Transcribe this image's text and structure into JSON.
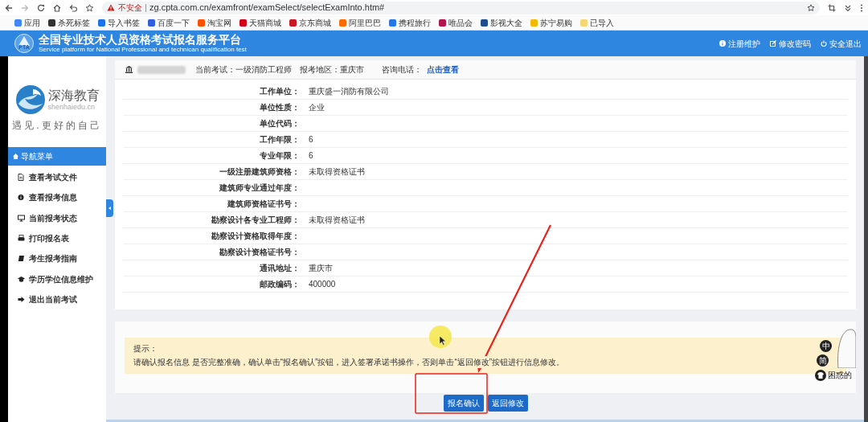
{
  "browser": {
    "security_label": "不安全",
    "url": "zg.cpta.com.cn/examfront/examSelect/selectExamInto.htm#",
    "bookmarks": [
      {
        "label": "应用",
        "color": "#4285f4"
      },
      {
        "label": "杀死标签",
        "color": "#333333"
      },
      {
        "label": "导入书签",
        "color": "#1a73e8"
      },
      {
        "label": "百度一下",
        "color": "#2f5ee0"
      },
      {
        "label": "淘宝网",
        "color": "#ff5000"
      },
      {
        "label": "天猫商城",
        "color": "#d4001a"
      },
      {
        "label": "京东商城",
        "color": "#c91623"
      },
      {
        "label": "阿里巴巴",
        "color": "#ff6a00"
      },
      {
        "label": "携程旅行",
        "color": "#2577e3"
      },
      {
        "label": "唯品会",
        "color": "#b5124e"
      },
      {
        "label": "影视大全",
        "color": "#1e4f8c"
      },
      {
        "label": "苏宁易购",
        "color": "#f5b800"
      },
      {
        "label": "已导入",
        "color": "#f7d774"
      }
    ]
  },
  "header": {
    "logo_text": "PTA",
    "title": "全国专业技术人员资格考试报名服务平台",
    "subtitle": "Service platform for National Professional and technican qualification test",
    "links": [
      "注册维护",
      "修改密码",
      "安全退出"
    ]
  },
  "sidebar": {
    "brand": "深海教育",
    "domain": "shenhaiedu.cn",
    "slogan": "遇见.更好的自己",
    "menu_title": "导航菜单",
    "items": [
      "查看考试文件",
      "查看报考信息",
      "当前报考状态",
      "打印报名表",
      "考生报考指南",
      "学历学位信息维护",
      "退出当前考试"
    ]
  },
  "exam_bar": {
    "exam": "当前考试：一级消防工程师",
    "region": "报考地区：重庆市",
    "hotline_label": "咨询电话：",
    "hotline_link": "点击查看"
  },
  "fields": [
    {
      "label": "工作单位：",
      "value": "重庆盛一消防有限公司"
    },
    {
      "label": "单位性质：",
      "value": "企业"
    },
    {
      "label": "单位代码："
    },
    {
      "label": "工作年限：",
      "value": "6"
    },
    {
      "label": "专业年限：",
      "value": "6"
    },
    {
      "label": "一级注册建筑师资格：",
      "value": "未取得资格证书"
    },
    {
      "label": "建筑师专业通过年度："
    },
    {
      "label": "建筑师资格证书号："
    },
    {
      "label": "勘察设计各专业工程师：",
      "value": "未取得资格证书"
    },
    {
      "label": "勘察设计资格取得年度："
    },
    {
      "label": "勘察设计资格证书号："
    },
    {
      "label": "通讯地址：",
      "value": "重庆市"
    },
    {
      "label": "邮政编码：",
      "value": "400000"
    }
  ],
  "notice": {
    "title": "提示：",
    "text": "请确认报名信息 是否完整准确，确认单击“报名确认”按钮，进入签署承诺书操作，否则单击“返回修改”按钮进行信息修改。"
  },
  "buttons": [
    "报名确认",
    "返回修改"
  ],
  "ime": {
    "items": [
      "中",
      "简"
    ],
    "caption": "困惑的"
  }
}
